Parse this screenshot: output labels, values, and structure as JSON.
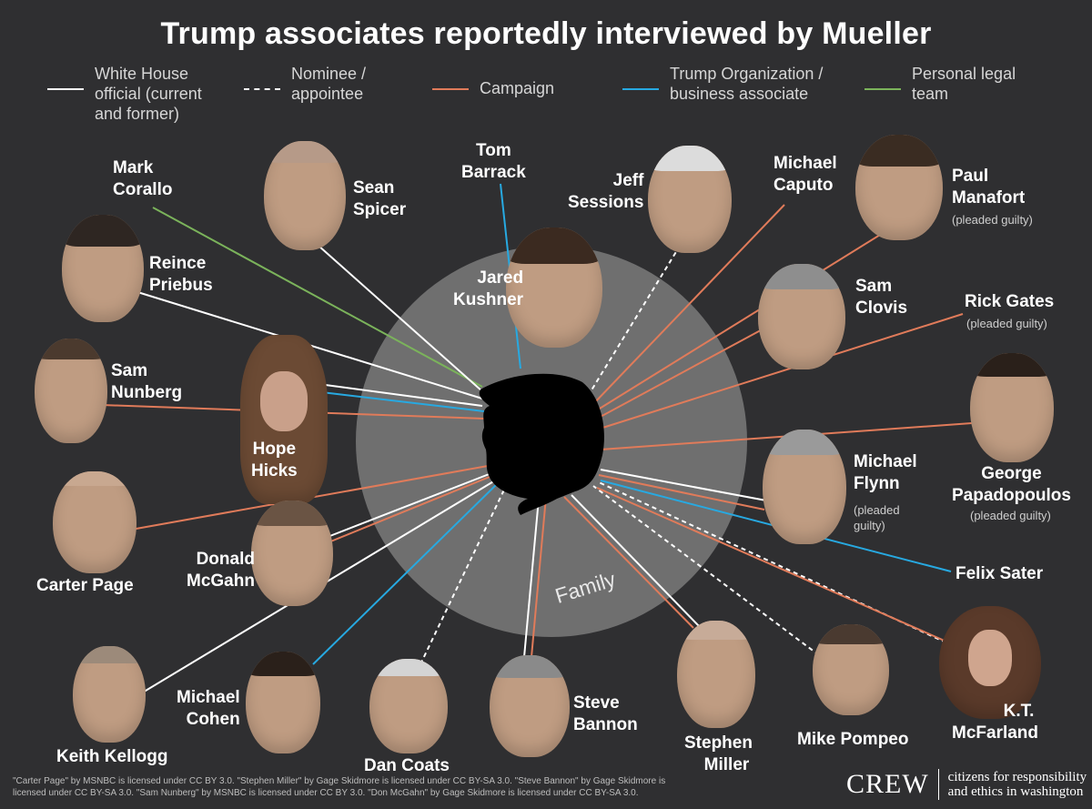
{
  "title": "Trump associates reportedly interviewed by Mueller",
  "colors": {
    "background": "#2f2f31",
    "white_house": "#ffffff",
    "nominee": "#ffffff",
    "campaign": "#e07b5a",
    "business": "#27a9e1",
    "legal": "#7bb35b",
    "family_circle": "#7a7a7a"
  },
  "legend": [
    {
      "label": "White House official (current and former)",
      "style": "solid-white"
    },
    {
      "label": "Nominee / appointee",
      "style": "dashed-white"
    },
    {
      "label": "Campaign",
      "style": "campaign"
    },
    {
      "label": "Trump Organization / business associate",
      "style": "business"
    },
    {
      "label": "Personal legal team",
      "style": "legal"
    }
  ],
  "family_label": "Family",
  "people": {
    "jared_kushner": {
      "name_line1": "Jared",
      "name_line2": "Kushner",
      "category": "family"
    },
    "mark_corallo": {
      "name_line1": "Mark",
      "name_line2": "Corallo",
      "category": "legal"
    },
    "sean_spicer": {
      "name_line1": "Sean",
      "name_line2": "Spicer",
      "category": "white_house"
    },
    "tom_barrack": {
      "name_line1": "Tom",
      "name_line2": "Barrack",
      "category": "business"
    },
    "jeff_sessions": {
      "name_line1": "Jeff",
      "name_line2": "Sessions",
      "category": "nominee"
    },
    "michael_caputo": {
      "name_line1": "Michael",
      "name_line2": "Caputo",
      "category": "campaign"
    },
    "paul_manafort": {
      "name_line1": "Paul",
      "name_line2": "Manafort",
      "note": "(pleaded guilty)",
      "category": "campaign"
    },
    "reince_priebus": {
      "name_line1": "Reince",
      "name_line2": "Priebus",
      "category": "white_house"
    },
    "sam_clovis": {
      "name_line1": "Sam",
      "name_line2": "Clovis",
      "category": "campaign"
    },
    "rick_gates": {
      "name_line1": "Rick Gates",
      "note": "(pleaded guilty)",
      "category": "campaign"
    },
    "sam_nunberg": {
      "name_line1": "Sam",
      "name_line2": "Nunberg",
      "category": "campaign"
    },
    "hope_hicks": {
      "name_line1": "Hope",
      "name_line2": "Hicks",
      "category": "white_house"
    },
    "george_papadopoulos": {
      "name_line1": "George",
      "name_line2": "Papadopoulos",
      "note": "(pleaded guilty)",
      "category": "campaign"
    },
    "michael_flynn": {
      "name_line1": "Michael",
      "name_line2": "Flynn",
      "note_line1": "(pleaded",
      "note_line2": "guilty)",
      "category": "white_house"
    },
    "carter_page": {
      "name_line1": "Carter Page",
      "category": "campaign"
    },
    "donald_mcgahn": {
      "name_line1": "Donald",
      "name_line2": "McGahn",
      "category": "white_house"
    },
    "felix_sater": {
      "name_line1": "Felix Sater",
      "category": "business"
    },
    "keith_kellogg": {
      "name_line1": "Keith Kellogg",
      "category": "white_house"
    },
    "michael_cohen": {
      "name_line1": "Michael",
      "name_line2": "Cohen",
      "category": "business"
    },
    "dan_coats": {
      "name_line1": "Dan Coats",
      "category": "nominee"
    },
    "steve_bannon": {
      "name_line1": "Steve",
      "name_line2": "Bannon",
      "category": "white_house"
    },
    "stephen_miller": {
      "name_line1": "Stephen",
      "name_line2": "Miller",
      "category": "white_house"
    },
    "mike_pompeo": {
      "name_line1": "Mike Pompeo",
      "category": "nominee"
    },
    "kt_mcfarland": {
      "name_line1": "K.T.",
      "name_line2": "McFarland",
      "category": "white_house"
    }
  },
  "credits": "\"Carter Page\" by MSNBC is licensed under CC BY 3.0. \"Stephen Miller\" by Gage Skidmore is licensed under CC BY-SA 3.0. \"Steve Bannon\" by Gage Skidmore is licensed under CC BY-SA 3.0. \"Sam Nunberg\" by MSNBC is licensed under CC BY 3.0. \"Don McGahn\" by Gage Skidmore is licensed under CC BY-SA 3.0.",
  "brand": {
    "wordmark": "CREW",
    "tagline_line1": "citizens for responsibility",
    "tagline_line2": "and ethics in washington"
  }
}
